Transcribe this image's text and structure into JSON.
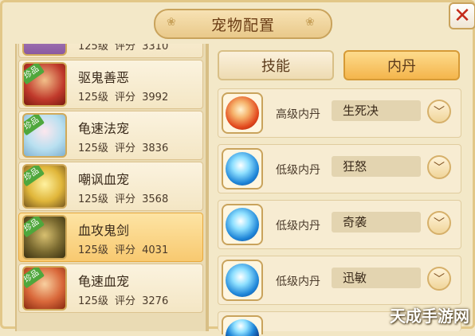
{
  "window": {
    "title": "宠物配置",
    "close_symbol": "✕"
  },
  "tabs": {
    "skill": "技能",
    "inner_core": "内丹"
  },
  "badge_text": "珍品",
  "pets": [
    {
      "level": "125级",
      "score_label": "评分",
      "score": "3310",
      "badge": false
    },
    {
      "name": "驱鬼善恶",
      "level": "125级",
      "score_label": "评分",
      "score": "3992",
      "badge": true
    },
    {
      "name": "龟速法宠",
      "level": "125级",
      "score_label": "评分",
      "score": "3836",
      "badge": true
    },
    {
      "name": "嘲讽血宠",
      "level": "125级",
      "score_label": "评分",
      "score": "3568",
      "badge": true
    },
    {
      "name": "血攻鬼剑",
      "level": "125级",
      "score_label": "评分",
      "score": "4031",
      "badge": true,
      "selected": true
    },
    {
      "name": "龟速血宠",
      "level": "125级",
      "score_label": "评分",
      "score": "3276",
      "badge": true
    }
  ],
  "inner_cores": [
    {
      "level": "高级内丹",
      "name": "生死决",
      "icon": "fire-orb-icon"
    },
    {
      "level": "低级内丹",
      "name": "狂怒",
      "icon": "ice-orb-icon"
    },
    {
      "level": "低级内丹",
      "name": "奇袭",
      "icon": "ice-orb-icon"
    },
    {
      "level": "低级内丹",
      "name": "迅敏",
      "icon": "ice-orb-icon"
    }
  ],
  "watermark": "天成手游网",
  "colors": {
    "selected_row": "#f8c970",
    "badge": "#4fa73c",
    "close": "#c42a1a"
  }
}
